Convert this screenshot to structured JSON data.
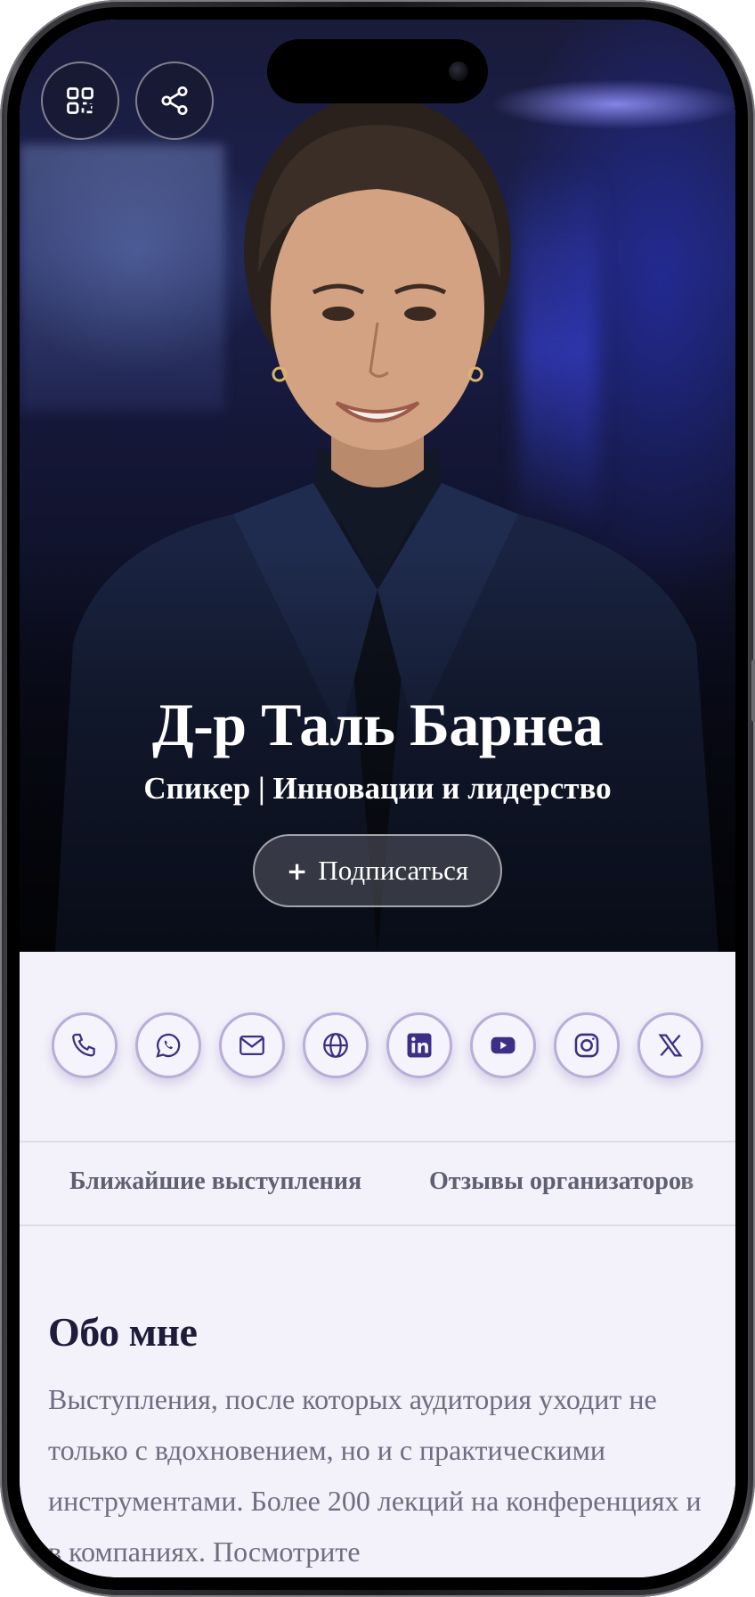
{
  "hero": {
    "name": "Д-р Таль Барнеа",
    "title": "Спикер | Инновации и лидерство",
    "subscribe_label": "Подписаться",
    "subscribe_icon": "plus-icon",
    "top_buttons": [
      "qr-code-icon",
      "share-icon"
    ]
  },
  "contacts": {
    "items": [
      {
        "icon": "phone-icon"
      },
      {
        "icon": "whatsapp-icon"
      },
      {
        "icon": "mail-icon"
      },
      {
        "icon": "globe-icon"
      },
      {
        "icon": "linkedin-icon"
      },
      {
        "icon": "youtube-icon"
      },
      {
        "icon": "instagram-icon"
      },
      {
        "icon": "x-icon"
      }
    ]
  },
  "tabs": [
    {
      "label": "Ближайшие выступления"
    },
    {
      "label": "Отзывы организаторов"
    }
  ],
  "about": {
    "heading": "Обо мне",
    "text": "Выступления, после которых аудитория уходит не только с вдохновением, но и с практическими инструментами. Более 200 лекций на конференциях и в компаниях. Посмотрите"
  },
  "colors": {
    "accent": "#3d2f85",
    "icon_border": "#b8addb",
    "page_bg": "#f3f1fa",
    "heading": "#1e1c3a",
    "body_text": "#6f6d80"
  }
}
